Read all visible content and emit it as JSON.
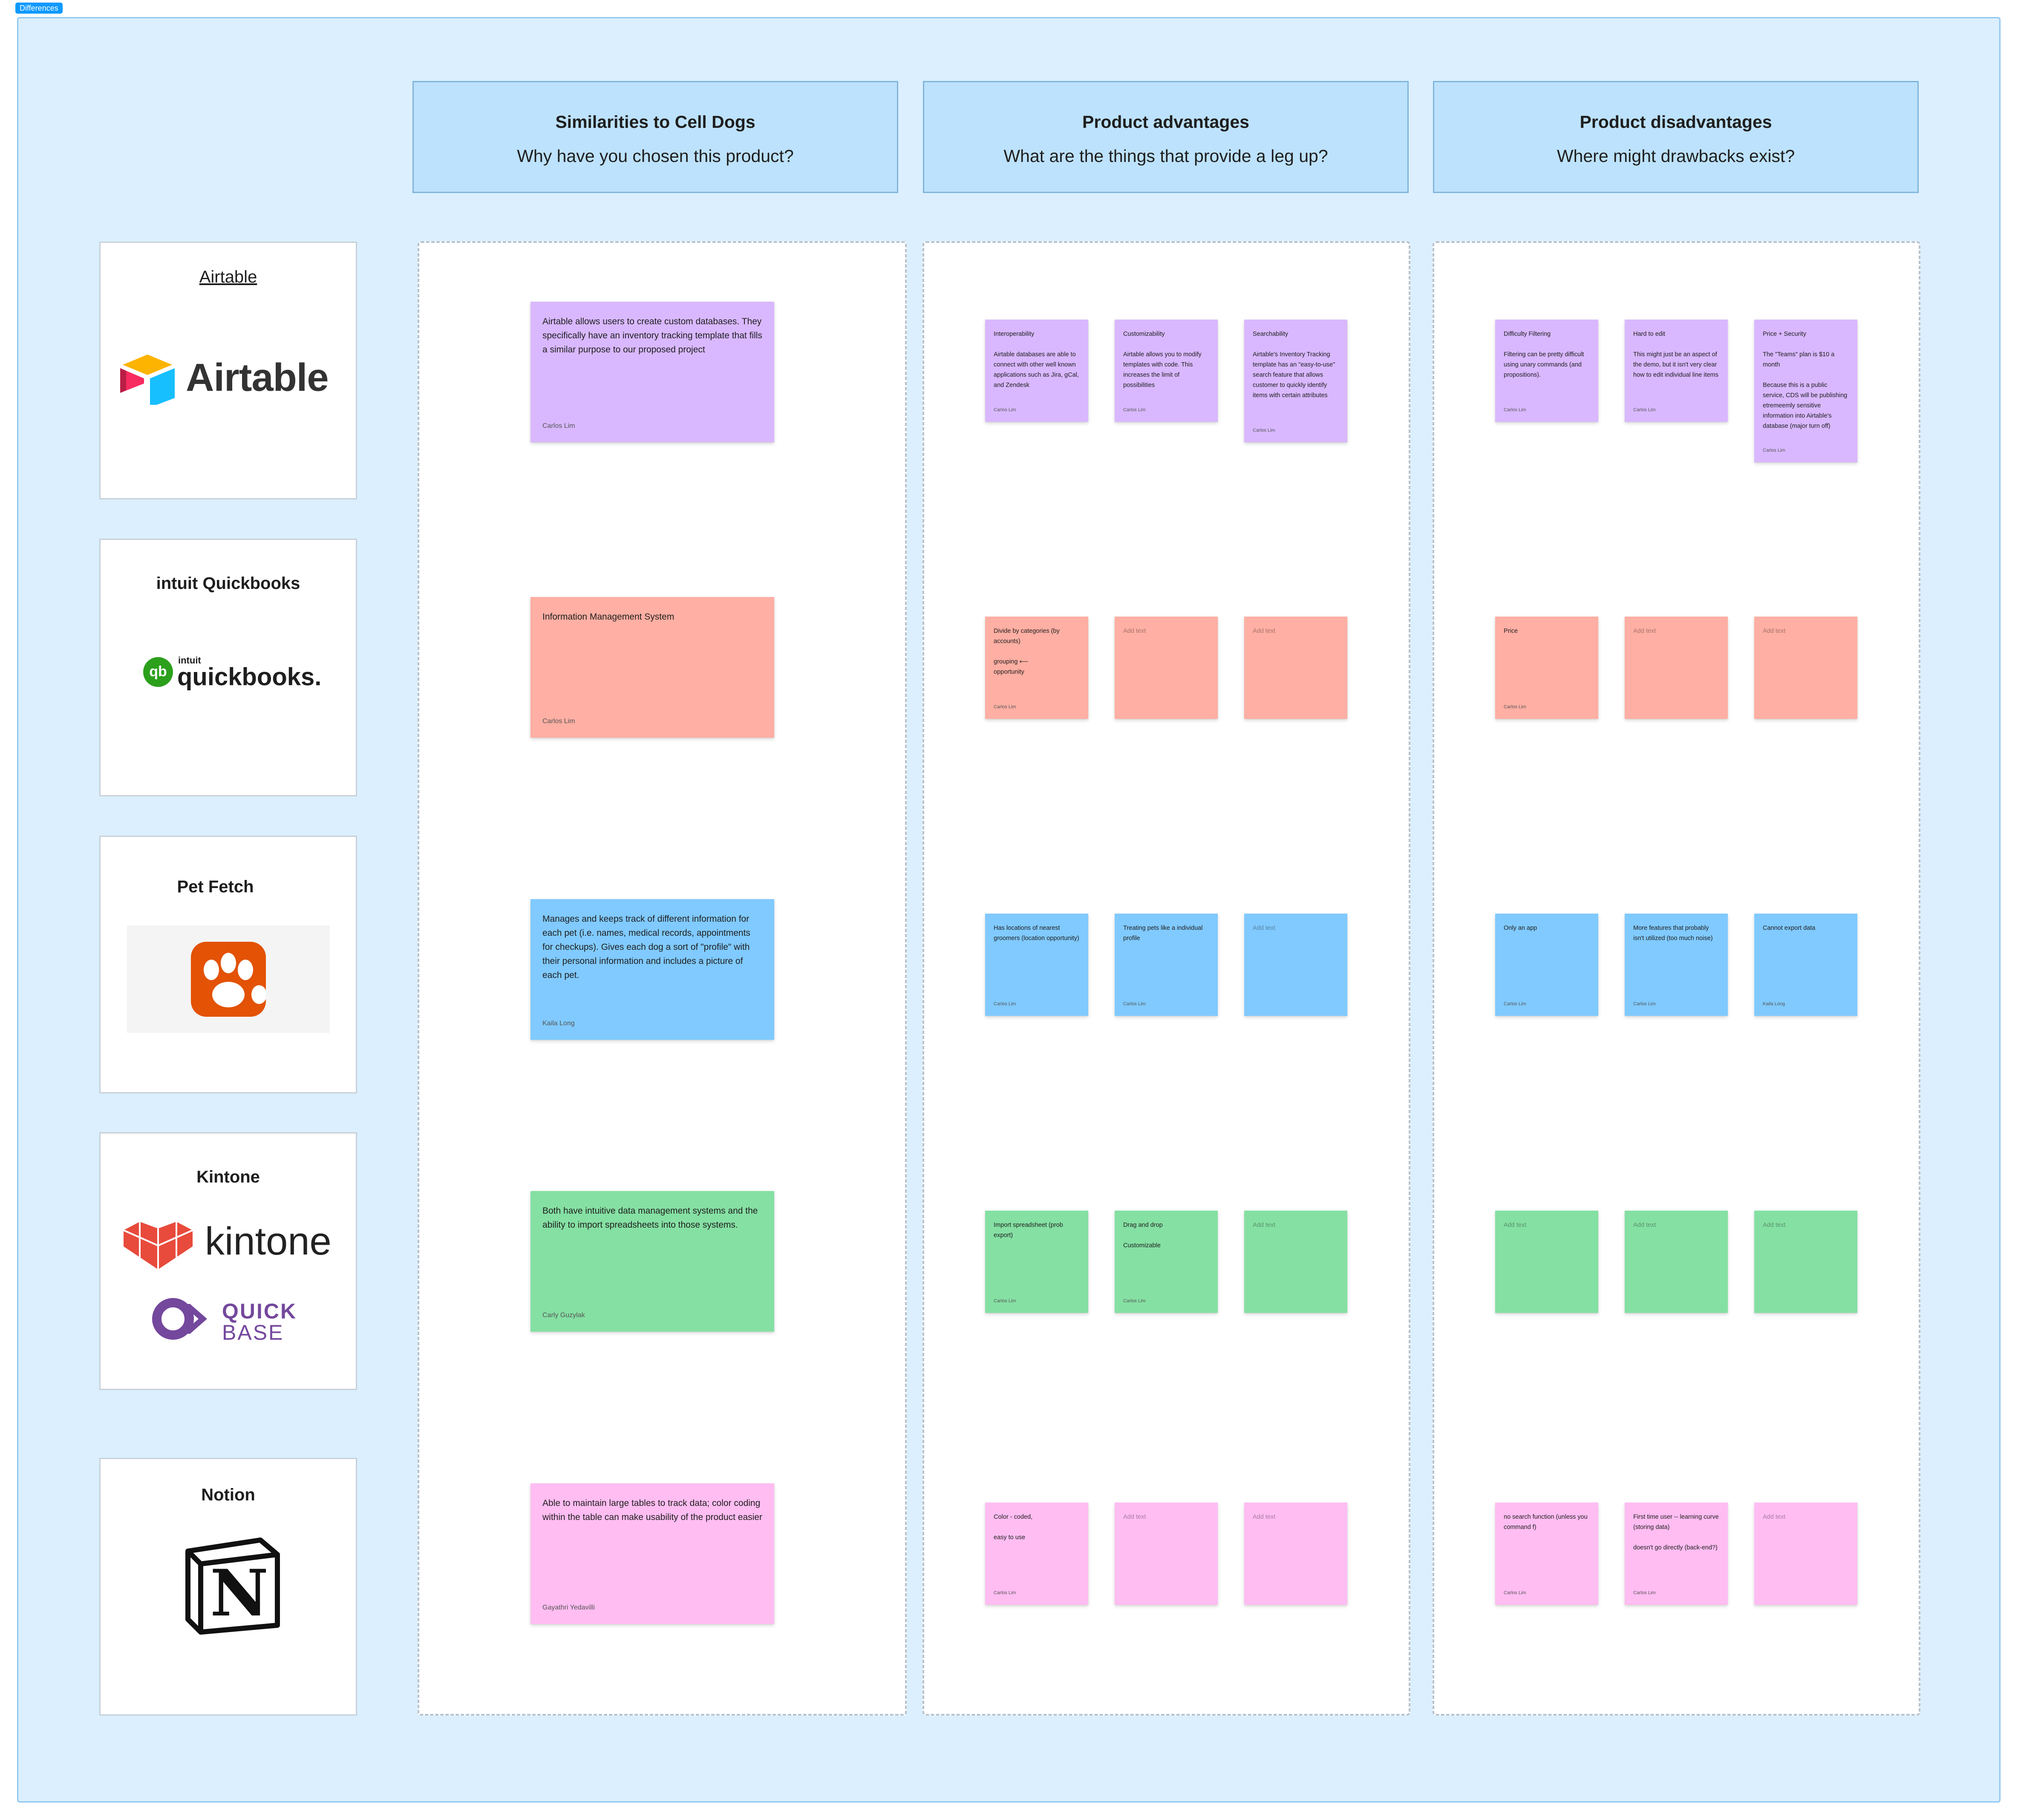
{
  "section": {
    "label": "Differences"
  },
  "columns": [
    {
      "title": "Similarities to Cell Dogs",
      "subtitle": "Why have you chosen this product?"
    },
    {
      "title": "Product advantages",
      "subtitle": "What are the things that provide a leg up?"
    },
    {
      "title": "Product disadvantages",
      "subtitle": "Where might drawbacks exist?"
    }
  ],
  "products": [
    {
      "name": "Airtable",
      "logo_text": "Airtable"
    },
    {
      "name": "intuit Quickbooks",
      "logo_small": "intuit",
      "logo_text": "quickbooks.",
      "logo_badge": "qb"
    },
    {
      "name": "Pet Fetch"
    },
    {
      "name": "Kintone",
      "logo_text": "kintone",
      "logo2_line1": "QUICK",
      "logo2_line2": "BASE"
    },
    {
      "name": "Notion",
      "logo_text": "N"
    }
  ],
  "colors": {
    "purple": "#d9b8ff",
    "salmon": "#ffafa3",
    "blue": "#80caff",
    "green": "#85e0a3",
    "pink": "#ffbdf2",
    "section_bg": "#dbefff",
    "header_bg": "#bde2fd"
  },
  "similarities": [
    {
      "text": "Airtable allows users to create custom databases. They specifically have an inventory tracking template that fills a similar purpose to our proposed project",
      "author": "Carlos Lim",
      "color": "purple"
    },
    {
      "text": "Information Management System",
      "author": "Carlos Lim",
      "color": "salmon"
    },
    {
      "text": "Manages and keeps track of different information for each pet (i.e. names, medical records, appointments for checkups). Gives each dog a sort of \"profile\" with their personal information and includes a picture of each pet.",
      "author": "Kaila Long",
      "color": "blue"
    },
    {
      "text": "Both have intuitive data management systems and the ability to import spreadsheets into those systems.",
      "author": "Carly Guzylak",
      "color": "green"
    },
    {
      "text": "Able to maintain large tables to track data; color coding within the table can make usability of the product easier",
      "author": "Gayathri Yedavilli",
      "color": "pink"
    }
  ],
  "advantages": [
    [
      {
        "text": "Interoperability\n\nAirtable databases are able to connect with other well known applications such as Jira, gCal, and Zendesk",
        "author": "Carlos Lim"
      },
      {
        "text": "Customizability\n\nAirtable allows you to modify templates with code. This increases the limit of possibilities",
        "author": "Carlos Lim"
      },
      {
        "text": "Searchability\n\nAirtable's Inventory Tracking template has an \"easy-to-use\" search feature that allows customer to quickly identify items with certain attributes",
        "author": "Carlos Lim"
      }
    ],
    [
      {
        "text": "Divide by categories (by accounts)\n\ngrouping ⟵\nopportunity",
        "author": "Carlos Lim"
      },
      {
        "text": "Add text",
        "author": ""
      },
      {
        "text": "Add text",
        "author": ""
      }
    ],
    [
      {
        "text": "Has locations of nearest groomers (location opportunity)",
        "author": "Carlos Lim"
      },
      {
        "text": "Treating pets like a individual profile",
        "author": "Carlos Lim"
      },
      {
        "text": "Add text",
        "author": ""
      }
    ],
    [
      {
        "text": "Import spreadsheet (prob export)",
        "author": "Carlos Lim"
      },
      {
        "text": "Drag and drop\n\nCustomizable",
        "author": "Carlos Lim"
      },
      {
        "text": "Add text",
        "author": ""
      }
    ],
    [
      {
        "text": "Color - coded,\n\neasy to use",
        "author": "Carlos Lim"
      },
      {
        "text": "Add text",
        "author": ""
      },
      {
        "text": "Add text",
        "author": ""
      }
    ]
  ],
  "disadvantages": [
    [
      {
        "text": "Difficulty Filtering\n\nFiltering can be pretty difficult using unary commands (and propositions).",
        "author": "Carlos Lim"
      },
      {
        "text": "Hard to edit\n\nThis might just be an aspect of the demo, but it isn't very clear how to edit individual line items",
        "author": "Carlos Lim"
      },
      {
        "text": "Price + Security\n\nThe \"Teams\" plan is $10 a month\n\nBecause this is a public service, CDS will be publishing etremeemly sensitive information into Airtable's database (major turn off)",
        "author": "Carlos Lim"
      }
    ],
    [
      {
        "text": "Price",
        "author": "Carlos Lim"
      },
      {
        "text": "Add text",
        "author": ""
      },
      {
        "text": "Add text",
        "author": ""
      }
    ],
    [
      {
        "text": "Only an app",
        "author": "Carlos Lim"
      },
      {
        "text": "More features that probably isn't utilized (too much noise)",
        "author": "Carlos Lim"
      },
      {
        "text": "Cannot export data",
        "author": "Kaila Long"
      }
    ],
    [
      {
        "text": "Add text",
        "author": ""
      },
      {
        "text": "Add text",
        "author": ""
      },
      {
        "text": "Add text",
        "author": ""
      }
    ],
    [
      {
        "text": "no search function (unless you command f)",
        "author": "Carlos Lim"
      },
      {
        "text": "First time user -- learning curve (storing data)\n\ndoesn't go directly (back-end?)",
        "author": "Carlos Lim"
      },
      {
        "text": "Add text",
        "author": ""
      }
    ]
  ]
}
